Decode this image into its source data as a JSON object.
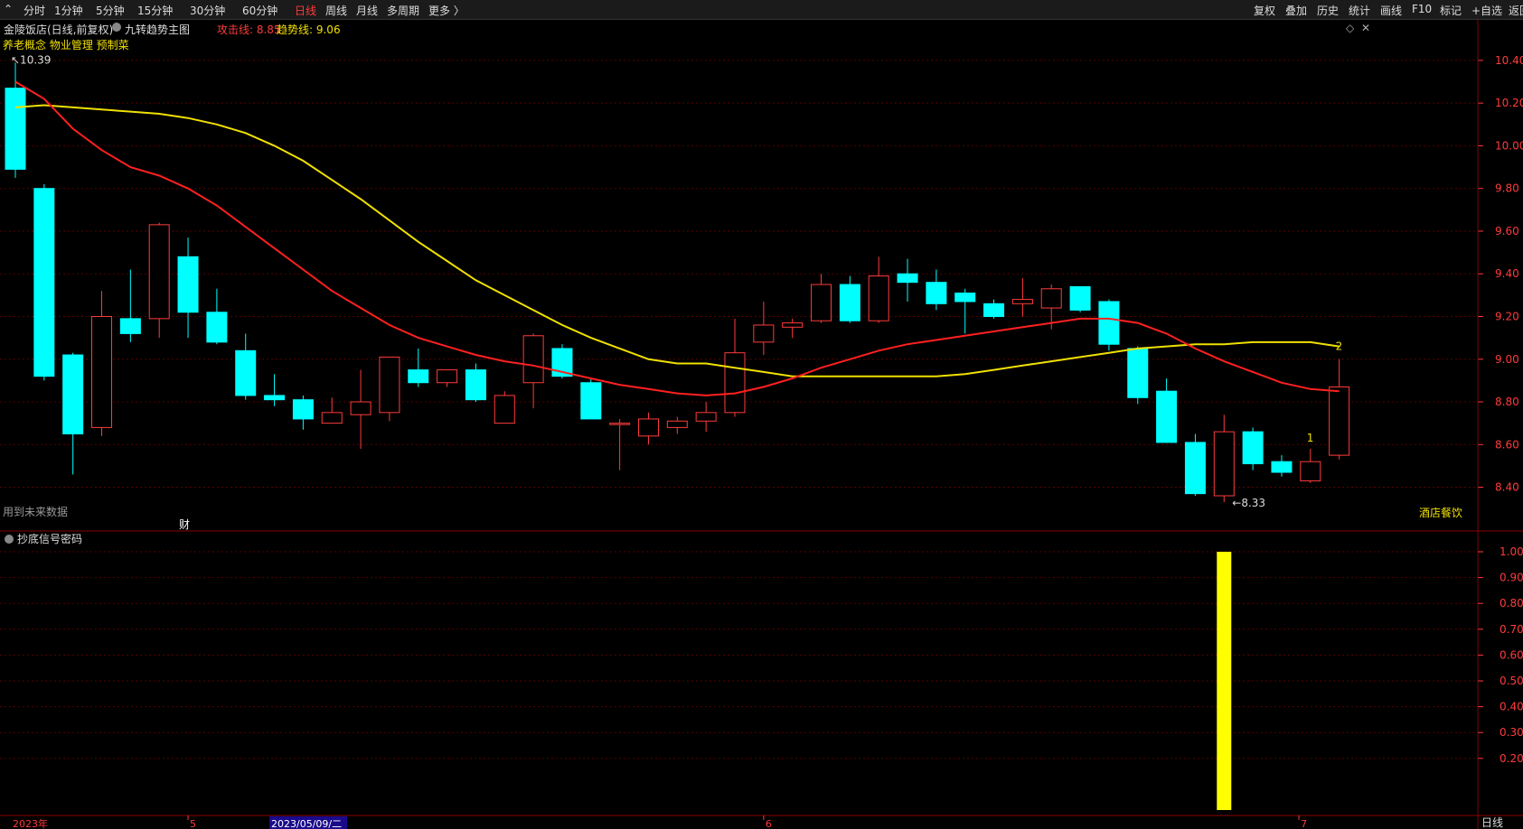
{
  "toolbar": {
    "left_items": [
      "分时",
      "1分钟",
      "5分钟",
      "15分钟",
      "30分钟",
      "60分钟",
      "日线",
      "周线",
      "月线",
      "多周期",
      "更多 〉"
    ],
    "active": "日线",
    "right_items": [
      "复权",
      "叠加",
      "历史",
      "统计",
      "画线",
      "F10",
      "标记",
      "+自选",
      "返回"
    ]
  },
  "header": {
    "stock_title": "金陵饭店(日线,前复权)",
    "indicator_name": "九转趋势主图",
    "attack_line": "攻击线: 8.85",
    "trend_line": "趋势线: 9.06",
    "concepts": "养老概念 物业管理 预制菜",
    "future_note": "用到未来数据",
    "finance_mark": "财",
    "industry": "酒店餐饮",
    "max_label": "10.39",
    "min_label": "8.33",
    "signal_1": "1",
    "signal_2": "2"
  },
  "sub_panel": {
    "title": "抄底信号密码",
    "period_label": "日线"
  },
  "x_axis": {
    "year_label": "2023年",
    "cursor_date": "2023/05/09/二",
    "month_labels": [
      "5",
      "6",
      "7"
    ]
  },
  "colors": {
    "up": "#ff3b3b",
    "down": "#00ffff",
    "attack_line": "#ff2020",
    "trend_line": "#f0e000",
    "signal_bar": "#ffff00",
    "grid": "#5a0000",
    "axis_text": "#ff3b3b"
  },
  "chart_data": [
    {
      "type": "candlestick",
      "title": "九转趋势主图",
      "y_ticks": [
        8.4,
        8.6,
        8.8,
        9.0,
        9.2,
        9.4,
        9.6,
        9.8,
        10.0,
        10.2,
        10.4
      ],
      "ylim": [
        8.25,
        10.48
      ],
      "candles": [
        {
          "o": 10.27,
          "h": 10.39,
          "l": 9.85,
          "c": 9.89
        },
        {
          "o": 9.8,
          "h": 9.82,
          "l": 8.9,
          "c": 8.92
        },
        {
          "o": 9.02,
          "h": 9.03,
          "l": 8.46,
          "c": 8.65
        },
        {
          "o": 8.68,
          "h": 9.32,
          "l": 8.64,
          "c": 9.2
        },
        {
          "o": 9.19,
          "h": 9.42,
          "l": 9.08,
          "c": 9.12
        },
        {
          "o": 9.19,
          "h": 9.64,
          "l": 9.1,
          "c": 9.63
        },
        {
          "o": 9.48,
          "h": 9.57,
          "l": 9.1,
          "c": 9.22
        },
        {
          "o": 9.22,
          "h": 9.33,
          "l": 9.07,
          "c": 9.08
        },
        {
          "o": 9.04,
          "h": 9.12,
          "l": 8.81,
          "c": 8.83
        },
        {
          "o": 8.83,
          "h": 8.93,
          "l": 8.78,
          "c": 8.81
        },
        {
          "o": 8.81,
          "h": 8.83,
          "l": 8.67,
          "c": 8.72
        },
        {
          "o": 8.7,
          "h": 8.82,
          "l": 8.7,
          "c": 8.75
        },
        {
          "o": 8.74,
          "h": 8.95,
          "l": 8.58,
          "c": 8.8
        },
        {
          "o": 8.75,
          "h": 9.01,
          "l": 8.71,
          "c": 9.01
        },
        {
          "o": 8.95,
          "h": 9.05,
          "l": 8.87,
          "c": 8.89
        },
        {
          "o": 8.89,
          "h": 8.95,
          "l": 8.87,
          "c": 8.95
        },
        {
          "o": 8.95,
          "h": 8.98,
          "l": 8.8,
          "c": 8.81
        },
        {
          "o": 8.7,
          "h": 8.85,
          "l": 8.7,
          "c": 8.83
        },
        {
          "o": 8.89,
          "h": 9.12,
          "l": 8.77,
          "c": 9.11
        },
        {
          "o": 9.05,
          "h": 9.07,
          "l": 8.91,
          "c": 8.92
        },
        {
          "o": 8.89,
          "h": 8.91,
          "l": 8.72,
          "c": 8.72
        },
        {
          "o": 8.7,
          "h": 8.72,
          "l": 8.48,
          "c": 8.7
        },
        {
          "o": 8.64,
          "h": 8.75,
          "l": 8.6,
          "c": 8.72
        },
        {
          "o": 8.68,
          "h": 8.73,
          "l": 8.65,
          "c": 8.71
        },
        {
          "o": 8.71,
          "h": 8.8,
          "l": 8.66,
          "c": 8.75
        },
        {
          "o": 8.75,
          "h": 9.19,
          "l": 8.73,
          "c": 9.03
        },
        {
          "o": 9.08,
          "h": 9.27,
          "l": 9.02,
          "c": 9.16
        },
        {
          "o": 9.15,
          "h": 9.19,
          "l": 9.1,
          "c": 9.17
        },
        {
          "o": 9.18,
          "h": 9.4,
          "l": 9.17,
          "c": 9.35
        },
        {
          "o": 9.35,
          "h": 9.39,
          "l": 9.17,
          "c": 9.18
        },
        {
          "o": 9.18,
          "h": 9.48,
          "l": 9.17,
          "c": 9.39
        },
        {
          "o": 9.4,
          "h": 9.47,
          "l": 9.27,
          "c": 9.36
        },
        {
          "o": 9.36,
          "h": 9.42,
          "l": 9.23,
          "c": 9.26
        },
        {
          "o": 9.31,
          "h": 9.33,
          "l": 9.12,
          "c": 9.27
        },
        {
          "o": 9.26,
          "h": 9.28,
          "l": 9.19,
          "c": 9.2
        },
        {
          "o": 9.26,
          "h": 9.38,
          "l": 9.2,
          "c": 9.28
        },
        {
          "o": 9.24,
          "h": 9.35,
          "l": 9.14,
          "c": 9.33
        },
        {
          "o": 9.34,
          "h": 9.34,
          "l": 9.22,
          "c": 9.23
        },
        {
          "o": 9.27,
          "h": 9.28,
          "l": 9.04,
          "c": 9.07
        },
        {
          "o": 9.05,
          "h": 9.06,
          "l": 8.79,
          "c": 8.82
        },
        {
          "o": 8.85,
          "h": 8.91,
          "l": 8.61,
          "c": 8.61
        },
        {
          "o": 8.61,
          "h": 8.65,
          "l": 8.36,
          "c": 8.37
        },
        {
          "o": 8.36,
          "h": 8.74,
          "l": 8.33,
          "c": 8.66
        },
        {
          "o": 8.66,
          "h": 8.68,
          "l": 8.48,
          "c": 8.51
        },
        {
          "o": 8.52,
          "h": 8.55,
          "l": 8.45,
          "c": 8.47
        },
        {
          "o": 8.43,
          "h": 8.58,
          "l": 8.42,
          "c": 8.52
        },
        {
          "o": 8.55,
          "h": 9.0,
          "l": 8.53,
          "c": 8.87
        }
      ],
      "series": [
        {
          "name": "攻击线",
          "values": [
            10.3,
            10.22,
            10.08,
            9.98,
            9.9,
            9.86,
            9.8,
            9.72,
            9.62,
            9.52,
            9.42,
            9.32,
            9.24,
            9.16,
            9.1,
            9.06,
            9.02,
            8.99,
            8.97,
            8.94,
            8.91,
            8.88,
            8.86,
            8.84,
            8.83,
            8.84,
            8.87,
            8.91,
            8.96,
            9.0,
            9.04,
            9.07,
            9.09,
            9.11,
            9.13,
            9.15,
            9.17,
            9.19,
            9.19,
            9.17,
            9.12,
            9.05,
            8.99,
            8.94,
            8.89,
            8.86,
            8.85
          ]
        },
        {
          "name": "趋势线",
          "values": [
            10.18,
            10.19,
            10.18,
            10.17,
            10.16,
            10.15,
            10.13,
            10.1,
            10.06,
            10.0,
            9.93,
            9.84,
            9.75,
            9.65,
            9.55,
            9.46,
            9.37,
            9.3,
            9.23,
            9.16,
            9.1,
            9.05,
            9.0,
            8.98,
            8.98,
            8.96,
            8.94,
            8.92,
            8.92,
            8.92,
            8.92,
            8.92,
            8.92,
            8.93,
            8.95,
            8.97,
            8.99,
            9.01,
            9.03,
            9.05,
            9.06,
            9.07,
            9.07,
            9.08,
            9.08,
            9.08,
            9.06
          ]
        }
      ]
    },
    {
      "type": "bar",
      "title": "抄底信号密码",
      "y_ticks": [
        0.2,
        0.3,
        0.4,
        0.5,
        0.6,
        0.7,
        0.8,
        0.9,
        1.0
      ],
      "ylim": [
        0.0,
        1.0
      ],
      "signal_index": 42,
      "signal_value": 1.0
    }
  ]
}
